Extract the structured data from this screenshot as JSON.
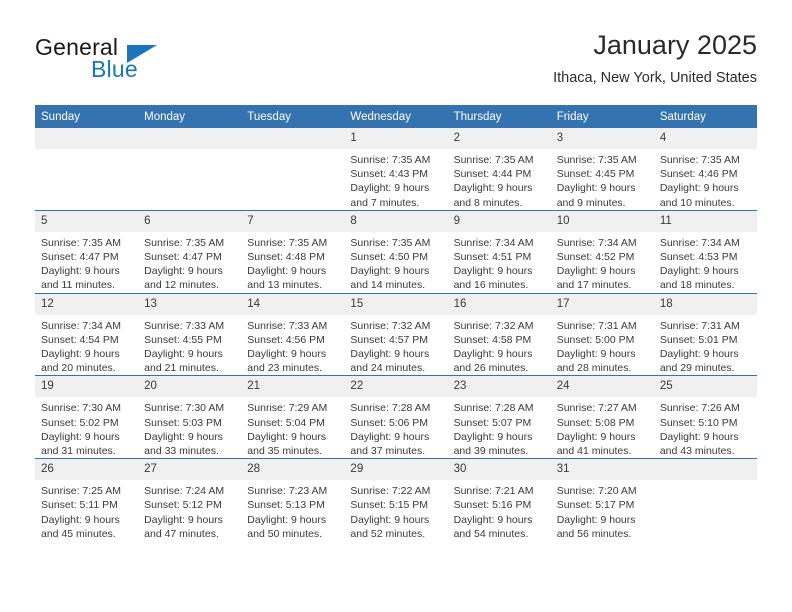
{
  "brand": {
    "word_one": "General",
    "word_two": "Blue",
    "accent_color": "#1b75bb"
  },
  "header": {
    "title": "January 2025",
    "subtitle": "Ithaca, New York, United States"
  },
  "calendar": {
    "header_color": "#3572b0",
    "daynum_band_color": "#f0f0f0",
    "weekday_headers": [
      "Sunday",
      "Monday",
      "Tuesday",
      "Wednesday",
      "Thursday",
      "Friday",
      "Saturday"
    ],
    "weeks": [
      [
        {
          "day": "",
          "lines": []
        },
        {
          "day": "",
          "lines": []
        },
        {
          "day": "",
          "lines": []
        },
        {
          "day": "1",
          "lines": [
            "Sunrise: 7:35 AM",
            "Sunset: 4:43 PM",
            "Daylight: 9 hours",
            "and 7 minutes."
          ]
        },
        {
          "day": "2",
          "lines": [
            "Sunrise: 7:35 AM",
            "Sunset: 4:44 PM",
            "Daylight: 9 hours",
            "and 8 minutes."
          ]
        },
        {
          "day": "3",
          "lines": [
            "Sunrise: 7:35 AM",
            "Sunset: 4:45 PM",
            "Daylight: 9 hours",
            "and 9 minutes."
          ]
        },
        {
          "day": "4",
          "lines": [
            "Sunrise: 7:35 AM",
            "Sunset: 4:46 PM",
            "Daylight: 9 hours",
            "and 10 minutes."
          ]
        }
      ],
      [
        {
          "day": "5",
          "lines": [
            "Sunrise: 7:35 AM",
            "Sunset: 4:47 PM",
            "Daylight: 9 hours",
            "and 11 minutes."
          ]
        },
        {
          "day": "6",
          "lines": [
            "Sunrise: 7:35 AM",
            "Sunset: 4:47 PM",
            "Daylight: 9 hours",
            "and 12 minutes."
          ]
        },
        {
          "day": "7",
          "lines": [
            "Sunrise: 7:35 AM",
            "Sunset: 4:48 PM",
            "Daylight: 9 hours",
            "and 13 minutes."
          ]
        },
        {
          "day": "8",
          "lines": [
            "Sunrise: 7:35 AM",
            "Sunset: 4:50 PM",
            "Daylight: 9 hours",
            "and 14 minutes."
          ]
        },
        {
          "day": "9",
          "lines": [
            "Sunrise: 7:34 AM",
            "Sunset: 4:51 PM",
            "Daylight: 9 hours",
            "and 16 minutes."
          ]
        },
        {
          "day": "10",
          "lines": [
            "Sunrise: 7:34 AM",
            "Sunset: 4:52 PM",
            "Daylight: 9 hours",
            "and 17 minutes."
          ]
        },
        {
          "day": "11",
          "lines": [
            "Sunrise: 7:34 AM",
            "Sunset: 4:53 PM",
            "Daylight: 9 hours",
            "and 18 minutes."
          ]
        }
      ],
      [
        {
          "day": "12",
          "lines": [
            "Sunrise: 7:34 AM",
            "Sunset: 4:54 PM",
            "Daylight: 9 hours",
            "and 20 minutes."
          ]
        },
        {
          "day": "13",
          "lines": [
            "Sunrise: 7:33 AM",
            "Sunset: 4:55 PM",
            "Daylight: 9 hours",
            "and 21 minutes."
          ]
        },
        {
          "day": "14",
          "lines": [
            "Sunrise: 7:33 AM",
            "Sunset: 4:56 PM",
            "Daylight: 9 hours",
            "and 23 minutes."
          ]
        },
        {
          "day": "15",
          "lines": [
            "Sunrise: 7:32 AM",
            "Sunset: 4:57 PM",
            "Daylight: 9 hours",
            "and 24 minutes."
          ]
        },
        {
          "day": "16",
          "lines": [
            "Sunrise: 7:32 AM",
            "Sunset: 4:58 PM",
            "Daylight: 9 hours",
            "and 26 minutes."
          ]
        },
        {
          "day": "17",
          "lines": [
            "Sunrise: 7:31 AM",
            "Sunset: 5:00 PM",
            "Daylight: 9 hours",
            "and 28 minutes."
          ]
        },
        {
          "day": "18",
          "lines": [
            "Sunrise: 7:31 AM",
            "Sunset: 5:01 PM",
            "Daylight: 9 hours",
            "and 29 minutes."
          ]
        }
      ],
      [
        {
          "day": "19",
          "lines": [
            "Sunrise: 7:30 AM",
            "Sunset: 5:02 PM",
            "Daylight: 9 hours",
            "and 31 minutes."
          ]
        },
        {
          "day": "20",
          "lines": [
            "Sunrise: 7:30 AM",
            "Sunset: 5:03 PM",
            "Daylight: 9 hours",
            "and 33 minutes."
          ]
        },
        {
          "day": "21",
          "lines": [
            "Sunrise: 7:29 AM",
            "Sunset: 5:04 PM",
            "Daylight: 9 hours",
            "and 35 minutes."
          ]
        },
        {
          "day": "22",
          "lines": [
            "Sunrise: 7:28 AM",
            "Sunset: 5:06 PM",
            "Daylight: 9 hours",
            "and 37 minutes."
          ]
        },
        {
          "day": "23",
          "lines": [
            "Sunrise: 7:28 AM",
            "Sunset: 5:07 PM",
            "Daylight: 9 hours",
            "and 39 minutes."
          ]
        },
        {
          "day": "24",
          "lines": [
            "Sunrise: 7:27 AM",
            "Sunset: 5:08 PM",
            "Daylight: 9 hours",
            "and 41 minutes."
          ]
        },
        {
          "day": "25",
          "lines": [
            "Sunrise: 7:26 AM",
            "Sunset: 5:10 PM",
            "Daylight: 9 hours",
            "and 43 minutes."
          ]
        }
      ],
      [
        {
          "day": "26",
          "lines": [
            "Sunrise: 7:25 AM",
            "Sunset: 5:11 PM",
            "Daylight: 9 hours",
            "and 45 minutes."
          ]
        },
        {
          "day": "27",
          "lines": [
            "Sunrise: 7:24 AM",
            "Sunset: 5:12 PM",
            "Daylight: 9 hours",
            "and 47 minutes."
          ]
        },
        {
          "day": "28",
          "lines": [
            "Sunrise: 7:23 AM",
            "Sunset: 5:13 PM",
            "Daylight: 9 hours",
            "and 50 minutes."
          ]
        },
        {
          "day": "29",
          "lines": [
            "Sunrise: 7:22 AM",
            "Sunset: 5:15 PM",
            "Daylight: 9 hours",
            "and 52 minutes."
          ]
        },
        {
          "day": "30",
          "lines": [
            "Sunrise: 7:21 AM",
            "Sunset: 5:16 PM",
            "Daylight: 9 hours",
            "and 54 minutes."
          ]
        },
        {
          "day": "31",
          "lines": [
            "Sunrise: 7:20 AM",
            "Sunset: 5:17 PM",
            "Daylight: 9 hours",
            "and 56 minutes."
          ]
        },
        {
          "day": "",
          "lines": []
        }
      ]
    ]
  }
}
